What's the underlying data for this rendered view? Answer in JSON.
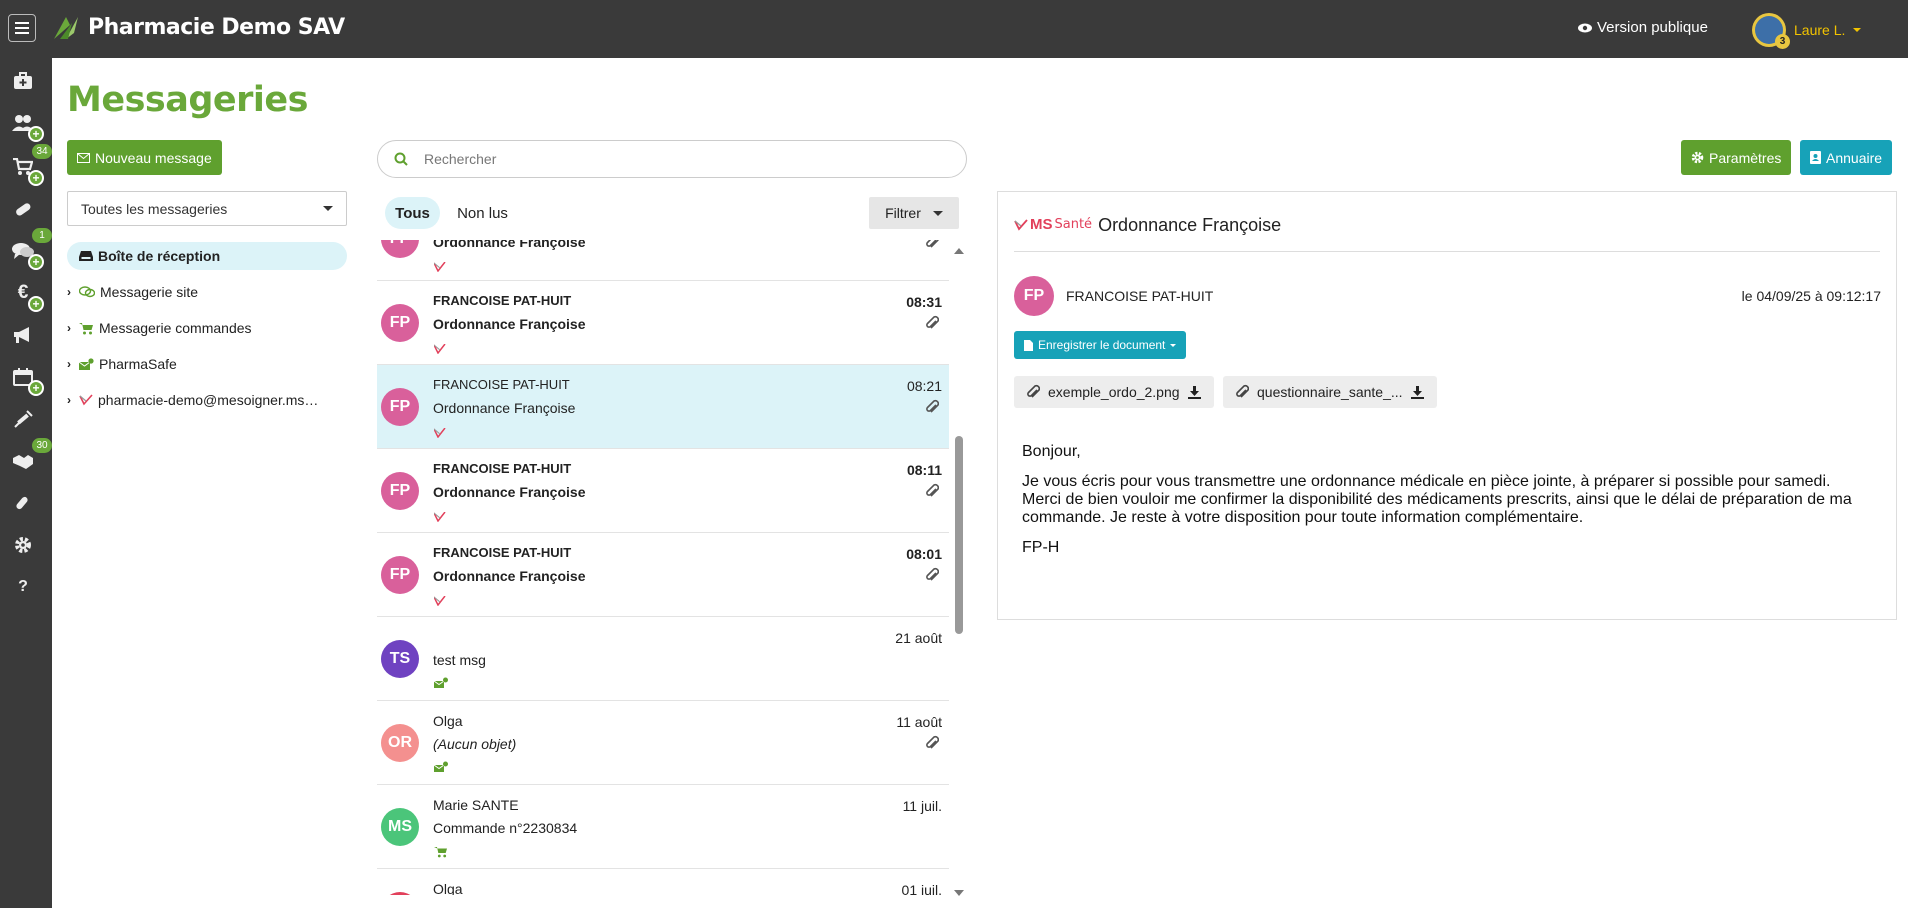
{
  "app": {
    "title": "Pharmacie Demo SAV",
    "public_version": "Version publique"
  },
  "user": {
    "name": "Laure L.",
    "badge": "3"
  },
  "nav": {
    "cart_count": "34",
    "chat_count": "1",
    "partners_count": "30"
  },
  "page": {
    "title": "Messageries"
  },
  "actions": {
    "new_message": "Nouveau message",
    "parameters": "Paramètres",
    "directory": "Annuaire"
  },
  "mailbox_select": {
    "value": "Toutes les messageries"
  },
  "folders": [
    {
      "label": "Boîte de réception"
    },
    {
      "label": "Messagerie site"
    },
    {
      "label": "Messagerie commandes"
    },
    {
      "label": "PharmaSafe"
    },
    {
      "label": "pharmacie-demo@mesoigner.mss..."
    }
  ],
  "search": {
    "placeholder": "Rechercher"
  },
  "tabs": {
    "all": "Tous",
    "unread": "Non lus"
  },
  "filter": {
    "label": "Filtrer"
  },
  "messages": [
    {
      "initials": "FP",
      "sender": "",
      "subject": "Ordonnance Françoise",
      "time": "",
      "color": "#d9609b"
    },
    {
      "initials": "FP",
      "sender": "FRANCOISE PAT-HUIT",
      "subject": "Ordonnance Françoise",
      "time": "08:31",
      "color": "#d9609b"
    },
    {
      "initials": "FP",
      "sender": "FRANCOISE PAT-HUIT",
      "subject": "Ordonnance Françoise",
      "time": "08:21",
      "color": "#d9609b"
    },
    {
      "initials": "FP",
      "sender": "FRANCOISE PAT-HUIT",
      "subject": "Ordonnance Françoise",
      "time": "08:11",
      "color": "#d9609b"
    },
    {
      "initials": "FP",
      "sender": "FRANCOISE PAT-HUIT",
      "subject": "Ordonnance Françoise",
      "time": "08:01",
      "color": "#d9609b"
    },
    {
      "initials": "TS",
      "sender": "",
      "subject": "test msg",
      "time": "21 août",
      "color": "#6f42c1"
    },
    {
      "initials": "OR",
      "sender": "Olga",
      "subject": "(Aucun objet)",
      "time": "11 août",
      "color": "#f4908f"
    },
    {
      "initials": "MS",
      "sender": "Marie SANTE",
      "subject": "Commande n°2230834",
      "time": "11 juil.",
      "color": "#4bc57a"
    },
    {
      "initials": "",
      "sender": "Olga",
      "subject": "",
      "time": "01 juil.",
      "color": "#e2405b"
    }
  ],
  "detail": {
    "subject": "Ordonnance Françoise",
    "logo_ms": "MS",
    "logo_sante": "Santé",
    "initials": "FP",
    "sender": "FRANCOISE PAT-HUIT",
    "date": "le 04/09/25 à 09:12:17",
    "save_document": "Enregistrer le document",
    "attachments": [
      "exemple_ordo_2.png",
      "questionnaire_sante_..."
    ],
    "body": {
      "greeting": "Bonjour,",
      "paragraph": "Je vous écris pour vous transmettre une ordonnance médicale en pièce jointe, à préparer si possible pour samedi. Merci de bien vouloir me confirmer la disponibilité des médicaments prescrits, ainsi que le délai de préparation de ma commande. Je reste à votre disposition pour toute information complémentaire.",
      "signature": "FP-H"
    }
  },
  "colors": {
    "accent_green": "#6aa83a",
    "accent_teal": "#17a2b8",
    "topbar": "#3a3a3a",
    "selected_row": "#dcf3f8"
  }
}
